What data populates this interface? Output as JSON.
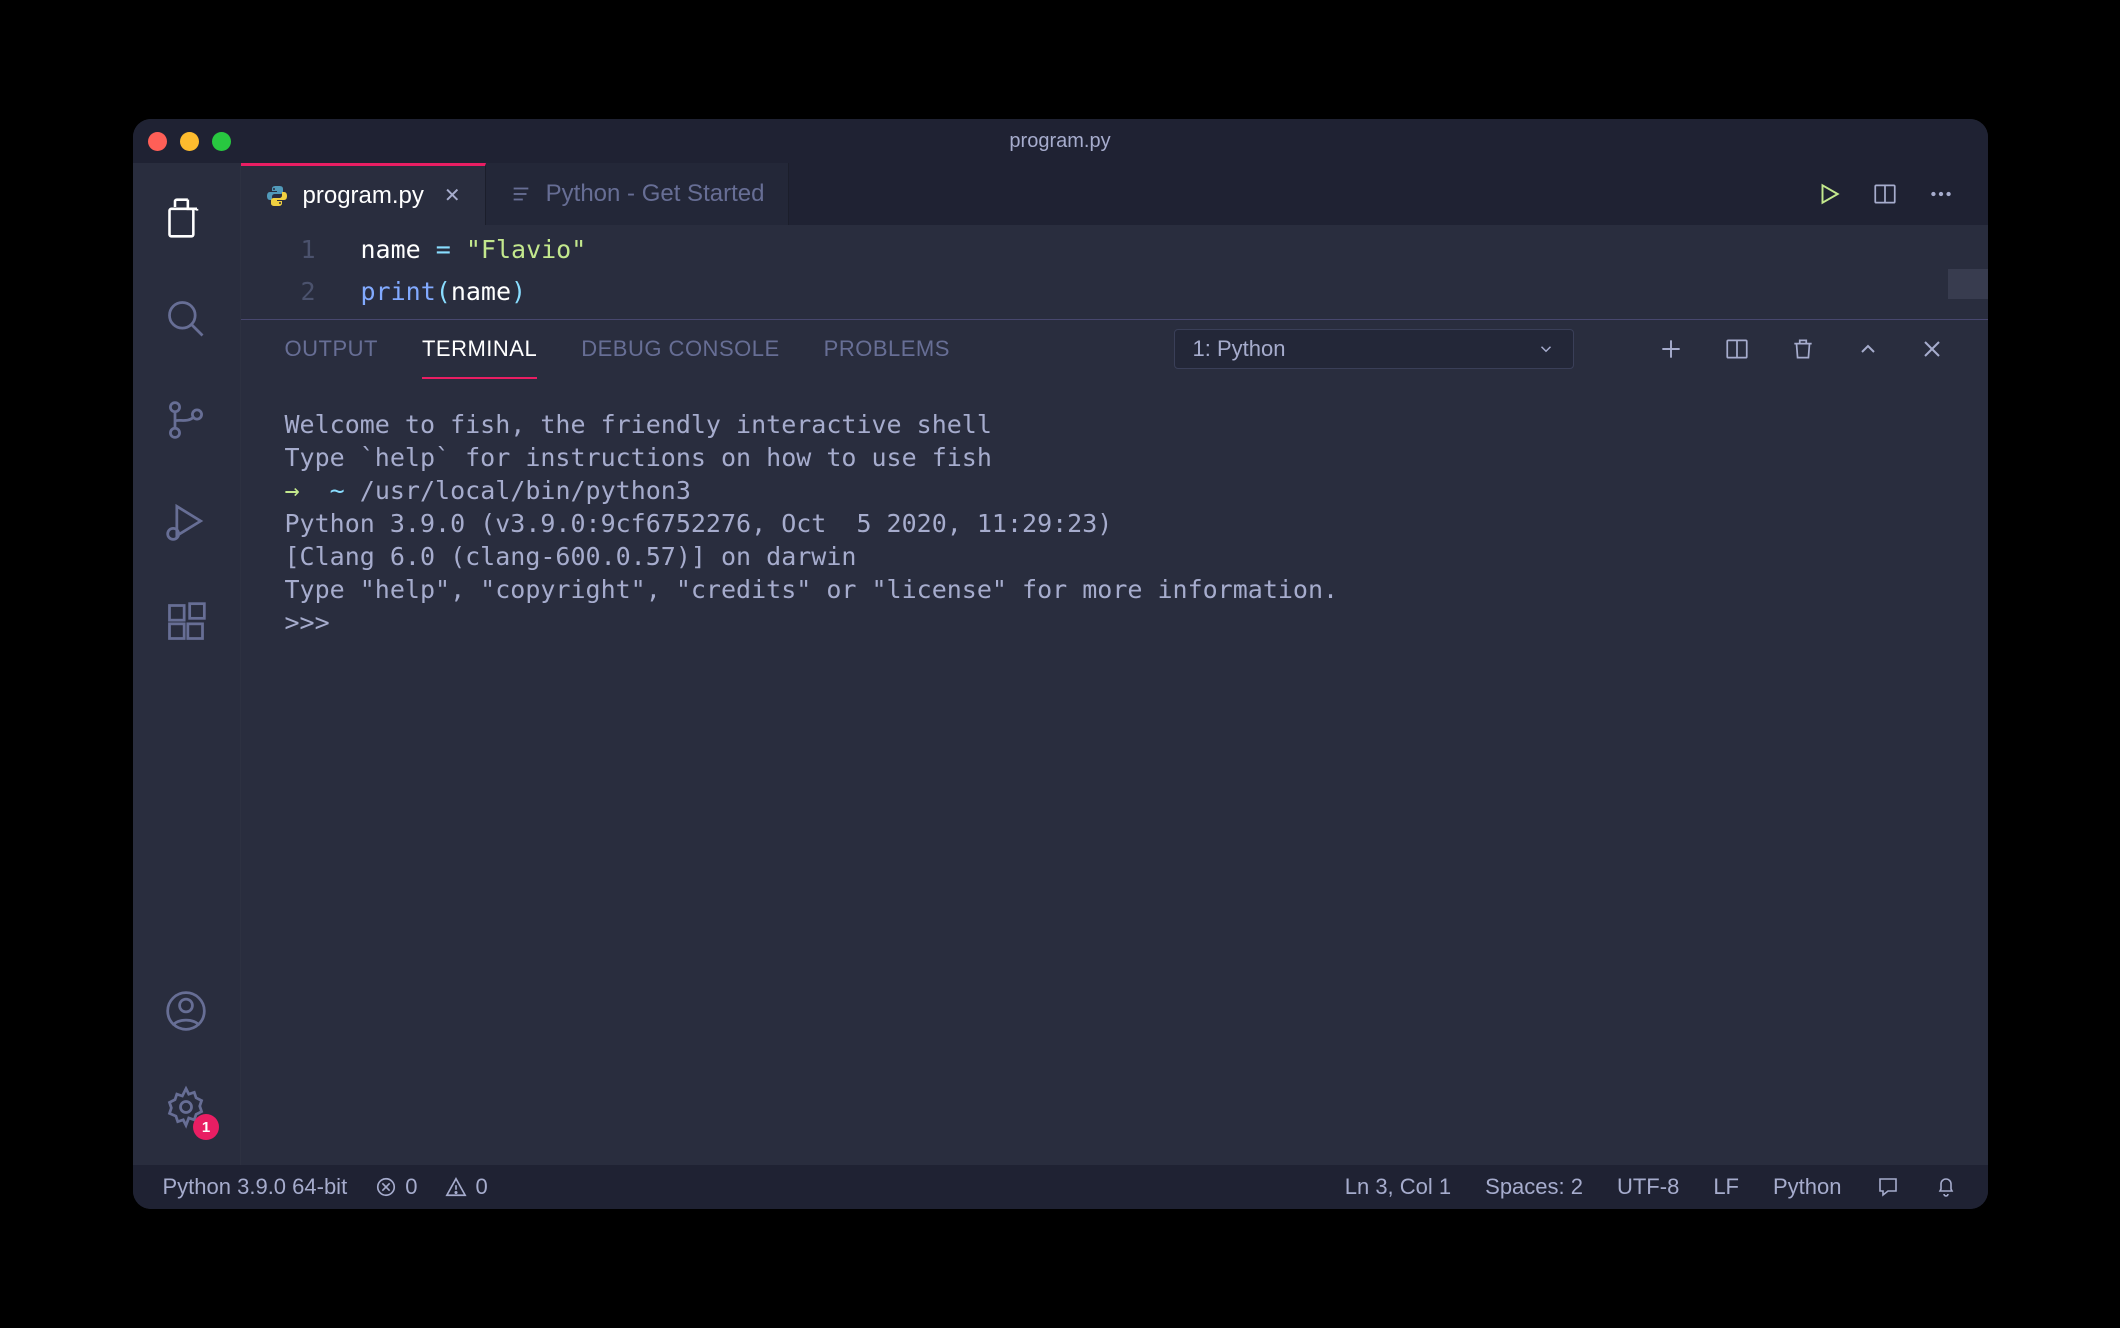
{
  "titlebar": {
    "title": "program.py"
  },
  "tabs": [
    {
      "icon": "python-icon",
      "label": "program.py",
      "active": true,
      "closeable": true
    },
    {
      "icon": "lines-icon",
      "label": "Python - Get Started",
      "active": false,
      "closeable": false
    }
  ],
  "editor": {
    "lines": [
      {
        "num": "1"
      },
      {
        "num": "2"
      }
    ],
    "code": {
      "line1_var": "name",
      "line1_eq": " = ",
      "line1_str": "\"Flavio\"",
      "line2_func": "print",
      "line2_open": "(",
      "line2_arg": "name",
      "line2_close": ")"
    }
  },
  "panel": {
    "tabs": [
      {
        "label": "OUTPUT",
        "active": false
      },
      {
        "label": "TERMINAL",
        "active": true
      },
      {
        "label": "DEBUG CONSOLE",
        "active": false
      },
      {
        "label": "PROBLEMS",
        "active": false
      }
    ],
    "terminal_selector": "1: Python",
    "terminal_lines": {
      "l1": "Welcome to fish, the friendly interactive shell",
      "l2": "Type `help` for instructions on how to use fish",
      "l3_arrow": "→",
      "l3_tilde": "  ~ ",
      "l3_cmd": "/usr/local/bin/python3",
      "l4": "Python 3.9.0 (v3.9.0:9cf6752276, Oct  5 2020, 11:29:23)",
      "l5": "[Clang 6.0 (clang-600.0.57)] on darwin",
      "l6": "Type \"help\", \"copyright\", \"credits\" or \"license\" for more information.",
      "l7": ">>>"
    }
  },
  "statusbar": {
    "python_version": "Python 3.9.0 64-bit",
    "errors": "0",
    "warnings": "0",
    "cursor": "Ln 3, Col 1",
    "spaces": "Spaces: 2",
    "encoding": "UTF-8",
    "eol": "LF",
    "language": "Python"
  },
  "activity_badge": "1"
}
